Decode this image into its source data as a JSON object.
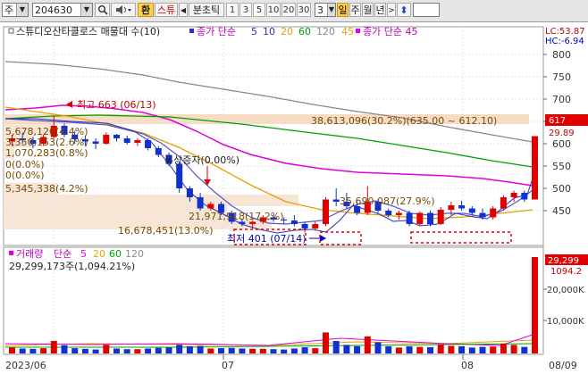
{
  "toolbar": {
    "market": "주",
    "code": "204630",
    "hwan": "환",
    "seutyu": "스튜",
    "prev": "◀",
    "bunchotik": "분초틱",
    "periods": [
      "1",
      "3",
      "5",
      "10",
      "20",
      "30"
    ],
    "count": "3",
    "il": "일",
    "ju": "주",
    "wol": "월",
    "nyeon": "년",
    "next": ">",
    "updown": "⬍"
  },
  "legend": {
    "price_name": "스튜디오산타클로스 매물대 수(10)",
    "ma_prefix": "종가 단순",
    "ma_periods": [
      "5",
      "10",
      "20",
      "60",
      "120",
      "45"
    ],
    "ma_colors": [
      "#3030c0",
      "#3030c0",
      "#e8a000",
      "#00a000",
      "#888888",
      "#e000e0"
    ],
    "ma2_label": "종가 단순 45",
    "lc": "LC:53.87",
    "hc": "HC:-6.94"
  },
  "price_axis": {
    "ticks": [
      "800",
      "750",
      "700",
      "650",
      "600",
      "550",
      "500",
      "450"
    ],
    "current": "617",
    "pct": "29.89"
  },
  "annotations": {
    "high": "최고 663 (06/13)",
    "low": "최저 401 (07/14)",
    "yusang": "유상증자(0.00%)",
    "vp_top": "38,613,096(30.2%)(635.00 ~ 612.10)",
    "vp_1": "5,678,120(4.4%)",
    "vp_2": "3,350,153(2.6%)",
    "vp_3": "1,070,283(0.8%)",
    "vp_4": "0(0.0%)",
    "vp_5": "0(0.0%)",
    "vp_6": "5,345,338(4.2%)",
    "vp_7": "21,971,918(17.2%)",
    "vp_8": "16,678,451(13.0%)",
    "vp_9": "35,690,087(27.9%)"
  },
  "volume_legend": {
    "label": "거래량",
    "ma_prefix": "단순",
    "periods": [
      "5",
      "20",
      "60",
      "120"
    ],
    "colors": [
      "#e000e0",
      "#e8a000",
      "#00a000",
      "#888888"
    ],
    "value": "29,299,173주(1,094.21%)"
  },
  "volume_axis": {
    "ticks": [
      "20,000K",
      "10,000K"
    ],
    "current": "29,299",
    "pct": "1094.2"
  },
  "date_axis": {
    "labels": [
      "2023/06",
      "07",
      "08",
      "08/09"
    ]
  },
  "chart_data": {
    "type": "candlestick",
    "ylim": [
      400,
      820
    ],
    "candles": [
      {
        "o": 605,
        "h": 620,
        "l": 595,
        "c": 612,
        "v": 1800
      },
      {
        "o": 612,
        "h": 625,
        "l": 600,
        "c": 608,
        "v": 1500
      },
      {
        "o": 608,
        "h": 615,
        "l": 590,
        "c": 600,
        "v": 1400
      },
      {
        "o": 600,
        "h": 620,
        "l": 595,
        "c": 615,
        "v": 1600
      },
      {
        "o": 615,
        "h": 663,
        "l": 612,
        "c": 640,
        "v": 3800
      },
      {
        "o": 640,
        "h": 645,
        "l": 615,
        "c": 620,
        "v": 2500
      },
      {
        "o": 620,
        "h": 628,
        "l": 600,
        "c": 610,
        "v": 1600
      },
      {
        "o": 610,
        "h": 618,
        "l": 595,
        "c": 605,
        "v": 1400
      },
      {
        "o": 605,
        "h": 612,
        "l": 588,
        "c": 600,
        "v": 1200
      },
      {
        "o": 600,
        "h": 625,
        "l": 598,
        "c": 620,
        "v": 2600
      },
      {
        "o": 620,
        "h": 622,
        "l": 605,
        "c": 612,
        "v": 1500
      },
      {
        "o": 612,
        "h": 618,
        "l": 598,
        "c": 602,
        "v": 1300
      },
      {
        "o": 602,
        "h": 612,
        "l": 595,
        "c": 608,
        "v": 1300
      },
      {
        "o": 608,
        "h": 612,
        "l": 585,
        "c": 590,
        "v": 1500
      },
      {
        "o": 590,
        "h": 595,
        "l": 570,
        "c": 575,
        "v": 1700
      },
      {
        "o": 575,
        "h": 580,
        "l": 550,
        "c": 555,
        "v": 1800
      },
      {
        "o": 555,
        "h": 560,
        "l": 490,
        "c": 500,
        "v": 2600
      },
      {
        "o": 500,
        "h": 505,
        "l": 470,
        "c": 480,
        "v": 2200
      },
      {
        "o": 480,
        "h": 490,
        "l": 450,
        "c": 455,
        "v": 2300
      },
      {
        "o": 455,
        "h": 470,
        "l": 450,
        "c": 465,
        "v": 1500
      },
      {
        "o": 465,
        "h": 470,
        "l": 440,
        "c": 445,
        "v": 1600
      },
      {
        "o": 445,
        "h": 450,
        "l": 420,
        "c": 425,
        "v": 1700
      },
      {
        "o": 425,
        "h": 432,
        "l": 415,
        "c": 420,
        "v": 1500
      },
      {
        "o": 420,
        "h": 428,
        "l": 410,
        "c": 425,
        "v": 1400
      },
      {
        "o": 425,
        "h": 440,
        "l": 420,
        "c": 435,
        "v": 1400
      },
      {
        "o": 435,
        "h": 440,
        "l": 425,
        "c": 430,
        "v": 1300
      },
      {
        "o": 430,
        "h": 435,
        "l": 420,
        "c": 428,
        "v": 1200
      },
      {
        "o": 428,
        "h": 440,
        "l": 415,
        "c": 420,
        "v": 1500
      },
      {
        "o": 420,
        "h": 425,
        "l": 401,
        "c": 410,
        "v": 1900
      },
      {
        "o": 410,
        "h": 425,
        "l": 405,
        "c": 420,
        "v": 1600
      },
      {
        "o": 420,
        "h": 480,
        "l": 415,
        "c": 475,
        "v": 6400
      },
      {
        "o": 475,
        "h": 500,
        "l": 460,
        "c": 470,
        "v": 3800
      },
      {
        "o": 470,
        "h": 490,
        "l": 455,
        "c": 460,
        "v": 2600
      },
      {
        "o": 460,
        "h": 470,
        "l": 440,
        "c": 445,
        "v": 2200
      },
      {
        "o": 445,
        "h": 505,
        "l": 440,
        "c": 470,
        "v": 5200
      },
      {
        "o": 470,
        "h": 475,
        "l": 445,
        "c": 450,
        "v": 3400
      },
      {
        "o": 450,
        "h": 455,
        "l": 435,
        "c": 440,
        "v": 2200
      },
      {
        "o": 440,
        "h": 450,
        "l": 430,
        "c": 445,
        "v": 1800
      },
      {
        "o": 445,
        "h": 450,
        "l": 415,
        "c": 420,
        "v": 2200
      },
      {
        "o": 420,
        "h": 448,
        "l": 415,
        "c": 445,
        "v": 2000
      },
      {
        "o": 445,
        "h": 450,
        "l": 415,
        "c": 420,
        "v": 1900
      },
      {
        "o": 420,
        "h": 458,
        "l": 418,
        "c": 452,
        "v": 2700
      },
      {
        "o": 452,
        "h": 470,
        "l": 440,
        "c": 462,
        "v": 2300
      },
      {
        "o": 462,
        "h": 472,
        "l": 450,
        "c": 455,
        "v": 2200
      },
      {
        "o": 455,
        "h": 460,
        "l": 440,
        "c": 445,
        "v": 1800
      },
      {
        "o": 445,
        "h": 455,
        "l": 430,
        "c": 435,
        "v": 2000
      },
      {
        "o": 435,
        "h": 460,
        "l": 430,
        "c": 455,
        "v": 2100
      },
      {
        "o": 455,
        "h": 485,
        "l": 450,
        "c": 480,
        "v": 3000
      },
      {
        "o": 480,
        "h": 495,
        "l": 470,
        "c": 490,
        "v": 2600
      },
      {
        "o": 490,
        "h": 495,
        "l": 470,
        "c": 475,
        "v": 2000
      },
      {
        "o": 475,
        "h": 617,
        "l": 475,
        "c": 617,
        "v": 29299
      }
    ]
  }
}
